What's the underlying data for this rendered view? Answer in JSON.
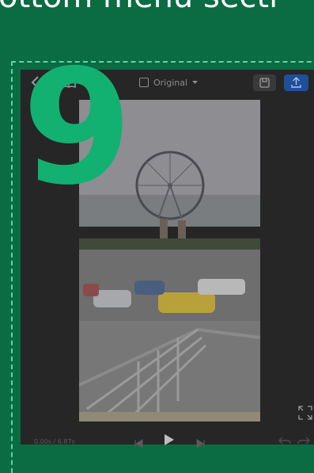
{
  "header": {
    "text": "ottom menu secti"
  },
  "step": {
    "number": "9"
  },
  "editor": {
    "aspect_ratio": "Original",
    "time": "0.00s",
    "duration": "/ 6.87s"
  },
  "colors": {
    "background": "#0b6b43",
    "step_number": "#12b171",
    "app_background": "#262626",
    "export_button": "#1f4f96"
  },
  "icons": [
    "back-icon",
    "book-icon",
    "ratio-icon",
    "chevron-down-icon",
    "save-icon",
    "export-icon",
    "fullscreen-icon",
    "skip-back-icon",
    "play-icon",
    "skip-forward-icon",
    "undo-icon",
    "redo-icon"
  ]
}
